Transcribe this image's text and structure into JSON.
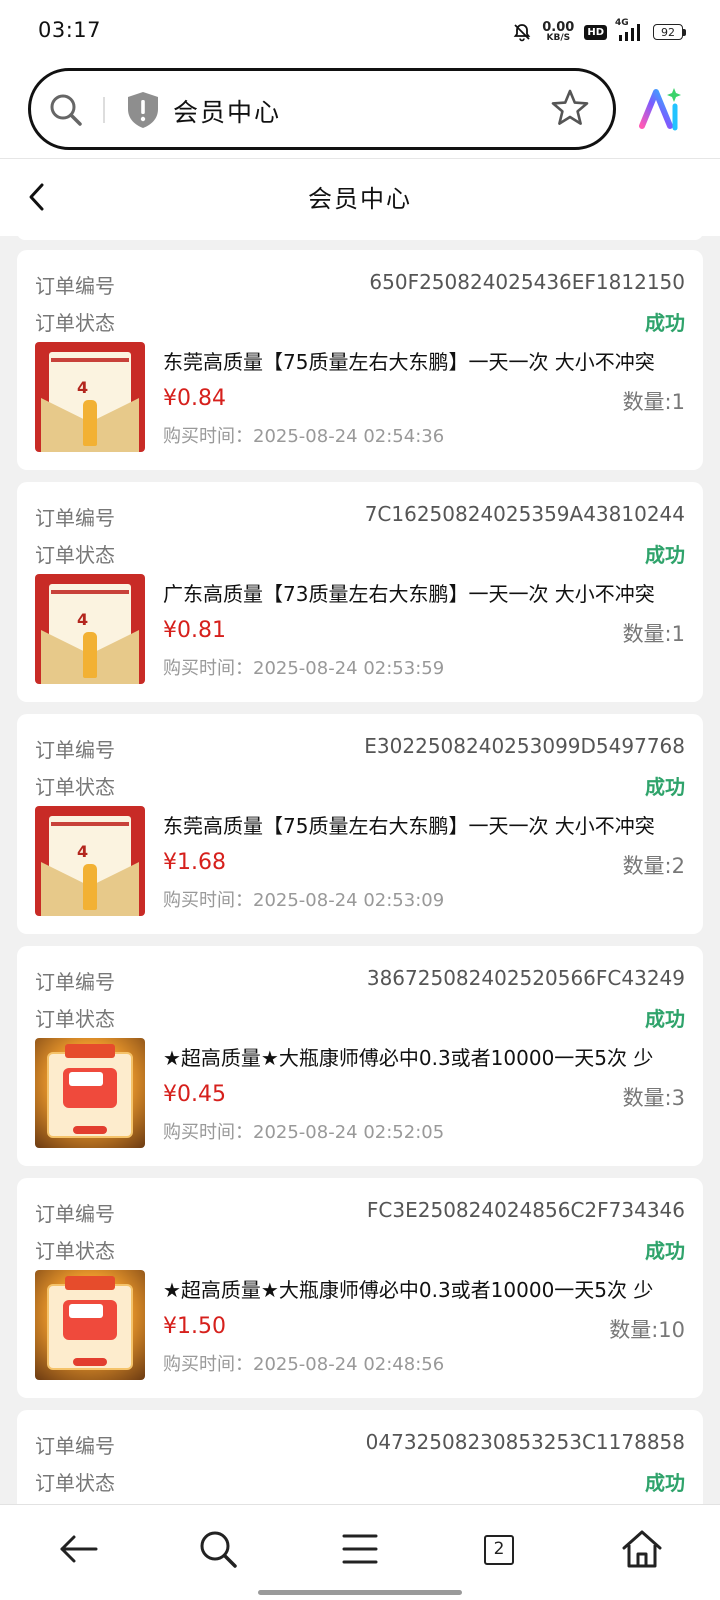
{
  "status_bar": {
    "time": "03:17",
    "net_speed_value": "0.00",
    "net_speed_unit": "KB/S",
    "hd_badge": "HD",
    "network": "4G",
    "battery": "92",
    "icons": [
      "mute-bell-icon",
      "signal-icon",
      "battery-icon"
    ]
  },
  "browser": {
    "url_text": "会员中心",
    "icons": [
      "search-icon",
      "shield-icon",
      "star-icon",
      "ai-icon"
    ]
  },
  "header": {
    "title": "会员中心",
    "back_icon": "chevron-left-icon"
  },
  "labels": {
    "order_no": "订单编号",
    "order_status": "订单状态",
    "buy_time_prefix": "购买时间："
  },
  "orders": [
    {
      "order_no": "650F250824025436EF1812150",
      "status": "成功",
      "name": "东莞高质量【75质量左右大东鹏】一天一次 大小不冲突",
      "price": "¥0.84",
      "quantity": "数量:1",
      "buy_time": "购买时间：2025-08-24 02:54:36",
      "thumb": "red-envelope"
    },
    {
      "order_no": "7C16250824025359A43810244",
      "status": "成功",
      "name": "广东高质量【73质量左右大东鹏】一天一次 大小不冲突",
      "price": "¥0.81",
      "quantity": "数量:1",
      "buy_time": "购买时间：2025-08-24 02:53:59",
      "thumb": "red-envelope"
    },
    {
      "order_no": "E3022508240253099D5497768",
      "status": "成功",
      "name": "东莞高质量【75质量左右大东鹏】一天一次 大小不冲突",
      "price": "¥1.68",
      "quantity": "数量:2",
      "buy_time": "购买时间：2025-08-24 02:53:09",
      "thumb": "red-envelope"
    },
    {
      "order_no": "386725082402520566FC43249",
      "status": "成功",
      "name": "★超高质量★大瓶康师傅必中0.3或者10000一天5次 少",
      "price": "¥0.45",
      "quantity": "数量:3",
      "buy_time": "购买时间：2025-08-24 02:52:05",
      "thumb": "gold-coupon"
    },
    {
      "order_no": "FC3E250824024856C2F734346",
      "status": "成功",
      "name": "★超高质量★大瓶康师傅必中0.3或者10000一天5次 少",
      "price": "¥1.50",
      "quantity": "数量:10",
      "buy_time": "购买时间：2025-08-24 02:48:56",
      "thumb": "gold-coupon"
    },
    {
      "order_no": "04732508230853253C1178858",
      "status": "成功",
      "name": "",
      "price": "",
      "quantity": "",
      "buy_time": "",
      "thumb": "none"
    }
  ],
  "bottom_nav": {
    "tab_count": "2",
    "icons": [
      "back-arrow-icon",
      "search-icon",
      "menu-icon",
      "tabs-icon",
      "home-icon"
    ]
  },
  "colors": {
    "success": "#2fa36b",
    "price": "#d6201c",
    "label": "#777777"
  }
}
